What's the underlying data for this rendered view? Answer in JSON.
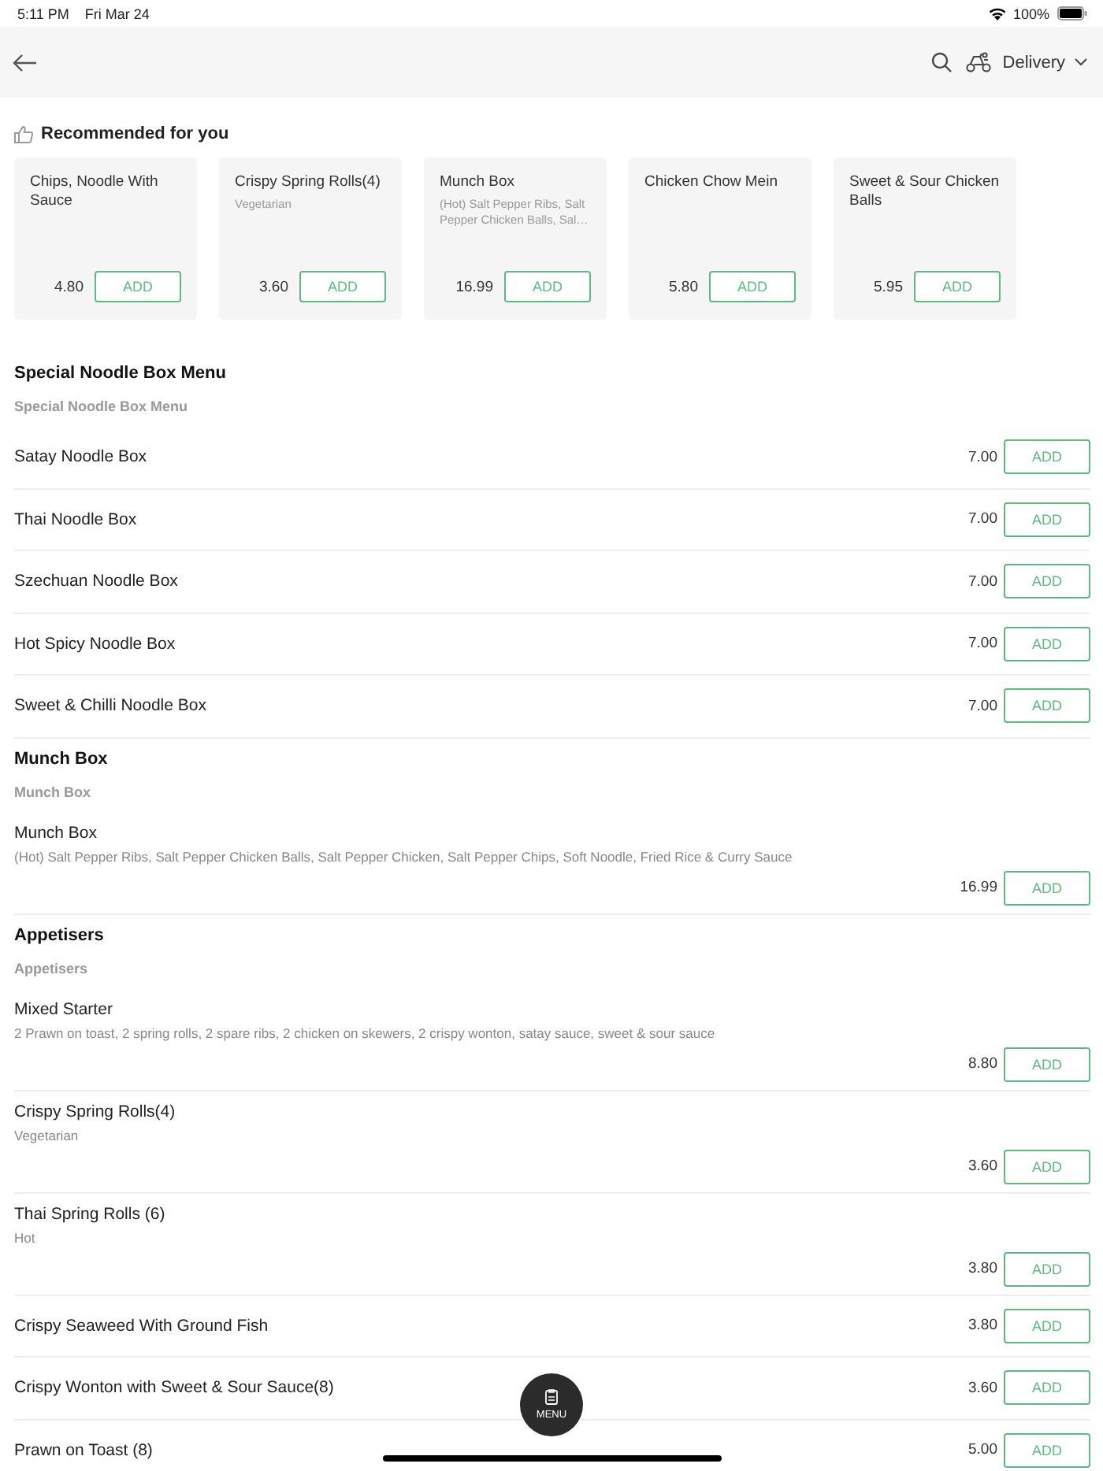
{
  "status_bar": {
    "time": "5:11 PM",
    "date": "Fri Mar 24",
    "battery": "100%"
  },
  "header": {
    "mode": "Delivery"
  },
  "recommended": {
    "title": "Recommended for you",
    "items": [
      {
        "name": "Chips, Noodle With Sauce",
        "price": "4.80",
        "button": "ADD"
      },
      {
        "name": "Crispy Spring Rolls(4)",
        "description": "Vegetarian",
        "price": "3.60",
        "button": "ADD"
      },
      {
        "name": "Munch Box",
        "description": "(Hot) Salt Pepper Ribs, Salt Pepper Chicken Balls, Sal…",
        "price": "16.99",
        "button": "ADD"
      },
      {
        "name": "Chicken Chow Mein",
        "price": "5.80",
        "button": "ADD"
      },
      {
        "name": "Sweet & Sour Chicken Balls",
        "price": "5.95",
        "button": "ADD"
      }
    ]
  },
  "sections": [
    {
      "title": "Special Noodle Box Menu",
      "subtitle": "Special Noodle Box Menu",
      "items": [
        {
          "kind": "simple",
          "name": "Satay Noodle Box",
          "price": "7.00",
          "button": "ADD"
        },
        {
          "kind": "simple",
          "name": "Thai Noodle Box",
          "price": "7.00",
          "button": "ADD"
        },
        {
          "kind": "simple",
          "name": "Szechuan Noodle Box",
          "price": "7.00",
          "button": "ADD"
        },
        {
          "kind": "simple",
          "name": "Hot Spicy Noodle Box",
          "price": "7.00",
          "button": "ADD"
        },
        {
          "kind": "simple",
          "name": "Sweet & Chilli Noodle Box",
          "price": "7.00",
          "button": "ADD"
        }
      ]
    },
    {
      "title": "Munch Box",
      "subtitle": "Munch Box",
      "items": [
        {
          "kind": "detailed",
          "name": "Munch Box",
          "description": "(Hot) Salt Pepper Ribs, Salt Pepper Chicken Balls, Salt Pepper Chicken, Salt Pepper Chips, Soft Noodle, Fried Rice & Curry Sauce",
          "price": "16.99",
          "button": "ADD"
        }
      ]
    },
    {
      "title": "Appetisers",
      "subtitle": "Appetisers",
      "items": [
        {
          "kind": "detailed",
          "name": "Mixed Starter",
          "description": "2 Prawn on toast, 2 spring rolls, 2 spare ribs, 2 chicken on skewers, 2 crispy wonton, satay sauce, sweet & sour sauce",
          "price": "8.80",
          "button": "ADD"
        },
        {
          "kind": "detailed",
          "name": "Crispy Spring Rolls(4)",
          "description": "Vegetarian",
          "price": "3.60",
          "button": "ADD"
        },
        {
          "kind": "detailed",
          "name": "Thai Spring Rolls (6)",
          "description": "Hot",
          "price": "3.80",
          "button": "ADD"
        },
        {
          "kind": "simple",
          "name": "Crispy Seaweed With Ground Fish",
          "price": "3.80",
          "button": "ADD"
        },
        {
          "kind": "simple",
          "name": "Crispy Wonton with Sweet & Sour Sauce(8)",
          "price": "3.60",
          "button": "ADD"
        },
        {
          "kind": "simple",
          "name": "Prawn on Toast (8)",
          "price": "5.00",
          "button": "ADD"
        }
      ]
    }
  ],
  "menu_button": {
    "label": "MENU"
  }
}
